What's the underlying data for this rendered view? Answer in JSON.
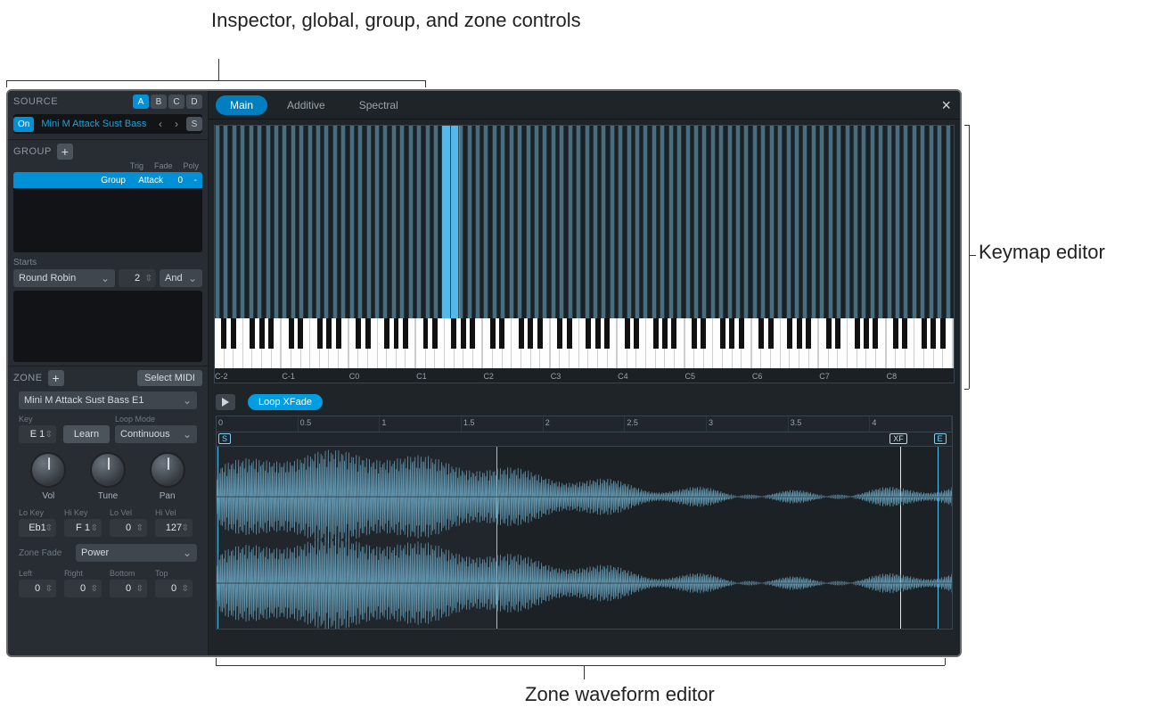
{
  "annotations": {
    "inspector": "Inspector, global, group, and zone controls",
    "keymap": "Keymap editor",
    "waveform": "Zone waveform editor"
  },
  "sidebar": {
    "source_title": "SOURCE",
    "source_tabs": [
      "A",
      "B",
      "C",
      "D"
    ],
    "source_tab_active": "A",
    "on_label": "On",
    "instrument_name": "Mini M Attack Sust Bass",
    "s_label": "S",
    "group_title": "GROUP",
    "group_cols": {
      "trig": "Trig",
      "fade": "Fade",
      "poly": "Poly"
    },
    "group_row": {
      "name": "Group",
      "trig": "Attack",
      "fade": "0",
      "poly": "-"
    },
    "starts_title": "Starts",
    "starts_mode": "Round Robin",
    "starts_count": "2",
    "starts_cond": "And",
    "zone_title": "ZONE",
    "select_midi": "Select MIDI",
    "zone_name": "Mini M Attack Sust Bass E1",
    "key_label": "Key",
    "key_value": "E 1",
    "learn": "Learn",
    "loopmode_label": "Loop Mode",
    "loopmode_value": "Continuous",
    "knobs": {
      "vol": "Vol",
      "tune": "Tune",
      "pan": "Pan"
    },
    "range_labels": {
      "lo_key": "Lo Key",
      "hi_key": "Hi Key",
      "lo_vel": "Lo Vel",
      "hi_vel": "Hi Vel"
    },
    "range_values": {
      "lo_key": "Eb1",
      "hi_key": "F 1",
      "lo_vel": "0",
      "hi_vel": "127"
    },
    "zone_fade_label": "Zone Fade",
    "zone_fade_value": "Power",
    "lrbt_labels": {
      "left": "Left",
      "right": "Right",
      "bottom": "Bottom",
      "top": "Top"
    },
    "lrbt_values": {
      "left": "0",
      "right": "0",
      "bottom": "0",
      "top": "0"
    }
  },
  "tabs": {
    "main": "Main",
    "additive": "Additive",
    "spectral": "Spectral",
    "active": "main"
  },
  "keymap": {
    "octave_labels": [
      "C-2",
      "C-1",
      "C0",
      "C1",
      "C2",
      "C3",
      "C4",
      "C5",
      "C6",
      "C7",
      "C8"
    ],
    "selected_stripe_pct": 31
  },
  "wave": {
    "loop_label": "Loop XFade",
    "time_ticks": [
      "0",
      "0.5",
      "1",
      "1.5",
      "2",
      "2.5",
      "3",
      "3.5",
      "4"
    ],
    "markers": {
      "start": "S",
      "xf": "XF",
      "end": "E"
    },
    "loop_start_pct": 38,
    "xf_pct": 93,
    "end_pct": 98
  }
}
